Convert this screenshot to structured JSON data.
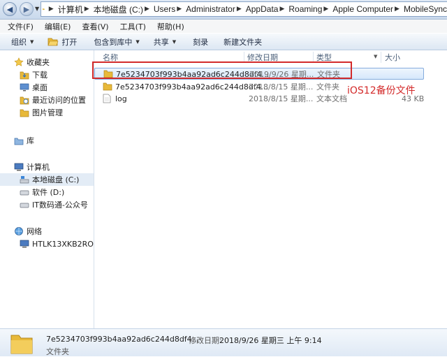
{
  "address": {
    "crumbs": [
      "计算机",
      "本地磁盘 (C:)",
      "Users",
      "Administrator",
      "AppData",
      "Roaming",
      "Apple Computer",
      "MobileSync"
    ]
  },
  "menu": [
    "文件(F)",
    "编辑(E)",
    "查看(V)",
    "工具(T)",
    "帮助(H)"
  ],
  "toolbar": {
    "organize": "组织",
    "open": "打开",
    "include": "包含到库中",
    "share": "共享",
    "burn": "刻录",
    "new_folder": "新建文件夹"
  },
  "nav": {
    "favorites": "收藏夹",
    "downloads": "下载",
    "desktop": "桌面",
    "recent": "最近访问的位置",
    "pictures": "图片管理",
    "libraries": "库",
    "computer": "计算机",
    "drive_c": "本地磁盘 (C:)",
    "drive_d": "软件 (D:)",
    "drive_it": "IT数码通-公众号",
    "network": "网络",
    "host": "HTLK13XKB2ROW..."
  },
  "columns": {
    "name": "名称",
    "modified": "修改日期",
    "type": "类型",
    "size": "大小"
  },
  "files": [
    {
      "name": "7e5234703f993b4aa92ad6c244d8df4...",
      "date": "2019/9/26 星期...",
      "type": "文件夹",
      "size": ""
    },
    {
      "name": "7e5234703f993b4aa92ad6c244d8df4...",
      "date": "2018/8/15 星期...",
      "type": "文件夹",
      "size": ""
    },
    {
      "name": "log",
      "date": "2018/8/15 星期...",
      "type": "文本文档",
      "size": "43 KB"
    }
  ],
  "annotation": "iOS12备份文件",
  "details": {
    "name": "7e5234703f993b4aa92ad6c244d8df4...",
    "modified_label": "修改日期:",
    "modified_value": "2018/9/26 星期三 上午 9:14",
    "type": "文件夹"
  },
  "colors": {
    "folder": "#e8b93a",
    "highlight_box": "#d32a2a",
    "selection": "#d6e8fb"
  }
}
